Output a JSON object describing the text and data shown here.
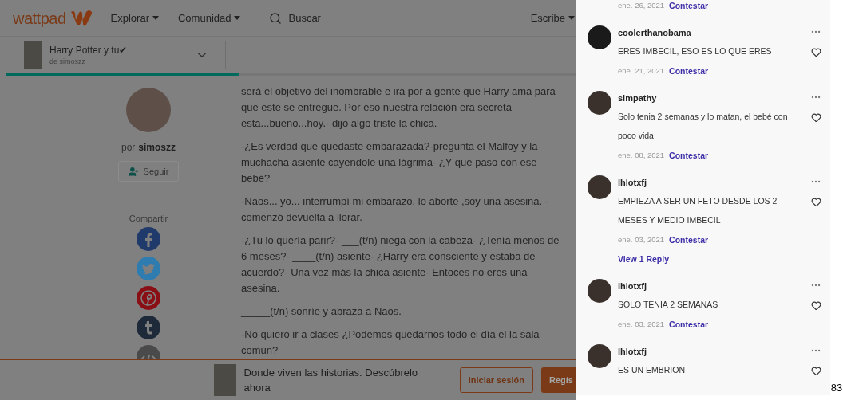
{
  "header": {
    "logo": "wattpad",
    "nav": [
      "Explorar",
      "Comunidad"
    ],
    "search": {
      "placeholder": "Buscar"
    },
    "write": "Escribe"
  },
  "story": {
    "title": "Harry Potter y tu✔",
    "author_line": "de simoszz",
    "progress": {
      "level": 0.41
    }
  },
  "author": {
    "prefix": "por",
    "name": "simoszz",
    "follow": "Seguir"
  },
  "share": {
    "label": "Compartir",
    "items": [
      {
        "kind": "facebook"
      },
      {
        "kind": "twitter"
      },
      {
        "kind": "pinterest"
      },
      {
        "kind": "tumblr"
      },
      {
        "kind": "embed"
      }
    ]
  },
  "paragraphs": [
    "será el objetivo del inombrable e irá por a gente que Harry ama para que este se entregue. Por eso nuestra relación era secreta esta...bueno...hoy.- dijo algo triste la chica.",
    "-¿Es verdad que quedaste embarazada?-pregunta el Malfoy y la muchacha asiente cayendole una lágrima- ¿Y que paso con ese bebé?",
    "-Naos... yo... interrumpí mi embarazo, lo aborte ,soy una asesina. -comenzó devuelta a llorar.",
    "-¿Tu lo quería parir?- ___(t/n) niega con la cabeza- ¿Tenía menos de 6 meses?- ____(t/n) asiente- ¿Harry era consciente y estaba de acuerdo?- Una vez más la chica asiente- Entoces no eres una asesina.",
    "_____(t/n) sonríe y abraza a Naos.",
    "-No quiero ir a clases ¿Podemos quedarnos todo el día el la sala común?"
  ],
  "signup_bar": {
    "text": "Donde viven las historias. Descúbrelo ahora",
    "login": "Iniciar sesión",
    "register": "Regís"
  },
  "comments": [
    {
      "date": "ene. 26, 2021",
      "reply": "Contestar"
    },
    {
      "user": "coolerthanobama",
      "text": "ERES IMBECIL, ESO ES LO QUE ERES",
      "date": "ene. 21, 2021",
      "reply": "Contestar"
    },
    {
      "user": "slmpathy",
      "text": "Solo tenia 2 semanas y lo matan, el bebé con poco vida",
      "date": "ene. 08, 2021",
      "reply": "Contestar"
    },
    {
      "user": "lhlotxfj",
      "text": "EMPIEZA A SER UN FETO DESDE LOS 2 MESES Y MEDIO IMBECIL",
      "date": "ene. 03, 2021",
      "reply": "Contestar",
      "replies": "View 1 Reply"
    },
    {
      "user": "lhlotxfj",
      "text": "SOLO TENIA 2 SEMANAS",
      "date": "ene. 03, 2021",
      "reply": "Contestar"
    },
    {
      "user": "lhlotxfj",
      "text": "ES UN EMBRION"
    }
  ],
  "edge_number": "83"
}
